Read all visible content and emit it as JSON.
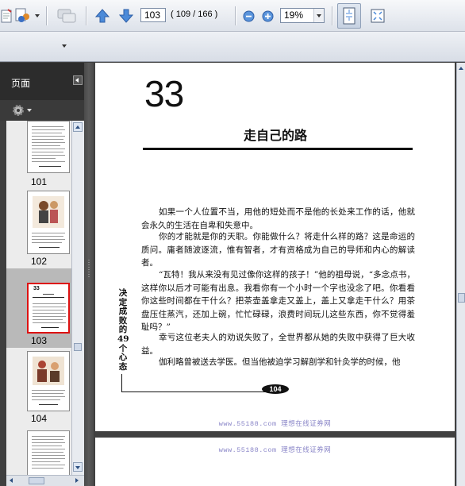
{
  "toolbar": {
    "page_number": "103",
    "page_count": "( 109 / 166 )",
    "zoom": "19%"
  },
  "navigation": {
    "title": "页面"
  },
  "thumbnails": [
    {
      "label": "101"
    },
    {
      "label": "102"
    },
    {
      "label": "103"
    },
    {
      "label": "104"
    }
  ],
  "document": {
    "chapter_number": "33",
    "chapter_title": "走自己的路",
    "paragraphs": [
      "如果一个人位置不当，用他的短处而不是他的长处来工作的话，他就会永久的生活在自卑和失意中。",
      "你的才能就是你的天职。你能做什么？将走什么样的路？这是命运的质问。庸者随波逐流，惟有智者，才有资格成为自己的导师和内心的解读者。",
      "“瓦特！我从来没有见过像你这样的孩子！”他的祖母说，“多念点书，这样你以后才可能有出息。我看你有一个小时一个字也没念了吧。你看看你这些时间都在干什么？把茶壶盖拿走又盖上，盖上又拿走干什么？用茶盘压住蒸汽，还加上碗，忙忙碌碌，浪费时间玩儿这些东西，你不觉得羞耻吗？”",
      "幸亏这位老夫人的劝说失败了，全世界都从她的失败中获得了巨大收益。",
      "伽利略曾被送去学医。但当他被迫学习解剖学和针灸学的时候，他"
    ],
    "side_title": "决定成败的49个心态",
    "folio": "104",
    "watermark": "www.55188.com 理想在线证券网"
  }
}
